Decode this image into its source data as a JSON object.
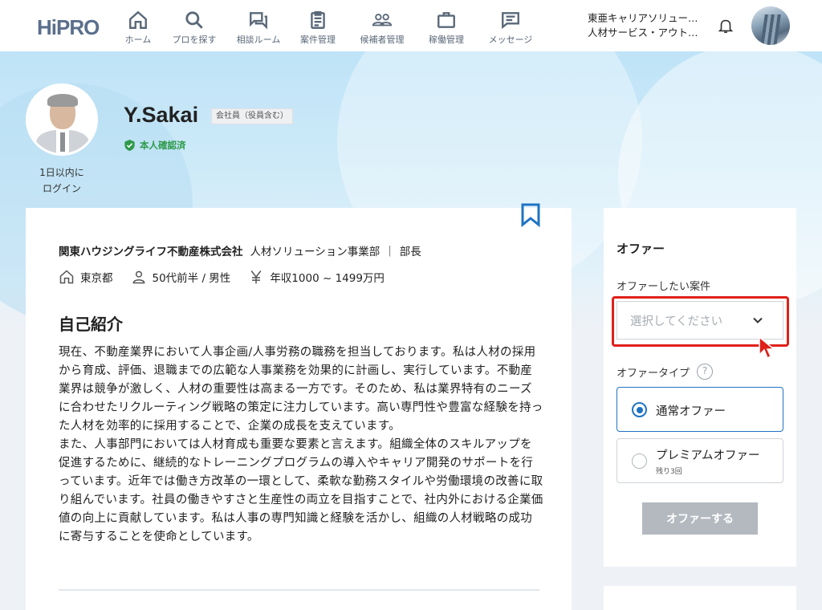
{
  "header": {
    "logo": "HiPRO",
    "nav": [
      {
        "id": "home",
        "label": "ホーム",
        "icon": "home-icon"
      },
      {
        "id": "search",
        "label": "プロを探す",
        "icon": "search-icon"
      },
      {
        "id": "consult",
        "label": "相談ルーム",
        "icon": "chat-icon"
      },
      {
        "id": "projects",
        "label": "案件管理",
        "icon": "clipboard-icon"
      },
      {
        "id": "candidates",
        "label": "候補者管理",
        "icon": "people-icon"
      },
      {
        "id": "work",
        "label": "稼働管理",
        "icon": "briefcase-icon"
      },
      {
        "id": "messages",
        "label": "メッセージ",
        "icon": "message-icon"
      }
    ],
    "company_line1": "東亜キャリアソリュー…",
    "company_line2": "人材サービス・アウト…"
  },
  "profile": {
    "login_line1": "1日以内に",
    "login_line2": "ログイン",
    "name": "Y.Sakai",
    "tag": "会社員（役員含む）",
    "verified": "本人確認済",
    "company": "関東ハウジングライフ不動産株式会社",
    "department": "人材ソリューション事業部",
    "position": "部長",
    "location": "東京都",
    "age_gender": "50代前半 / 男性",
    "income": "年収1000 ~ 1499万円"
  },
  "intro": {
    "title": "自己紹介",
    "body": "現在、不動産業界において人事企画/人事労務の職務を担当しております。私は人材の採用から育成、評価、退職までの広範な人事業務を効果的に計画し、実行しています。不動産業界は競争が激しく、人材の重要性は高まる一方です。そのため、私は業界特有のニーズに合わせたリクルーティング戦略の策定に注力しています。高い専門性や豊富な経験を持った人材を効率的に採用することで、企業の成長を支えています。\nまた、人事部門においては人材育成も重要な要素と言えます。組織全体のスキルアップを促進するために、継続的なトレーニングプログラムの導入やキャリア開発のサポートを行っています。近年では働き方改革の一環として、柔軟な勤務スタイルや労働環境の改善に取り組んでいます。社員の働きやすさと生産性の両立を目指すことで、社内外における企業価値の向上に貢献しています。私は人事の専門知識と経験を活かし、組織の人材戦略の成功に寄与することを使命としています。"
  },
  "offer": {
    "title": "オファー",
    "project_label": "オファーしたい案件",
    "project_placeholder": "選択してください",
    "type_label": "オファータイプ",
    "help": "?",
    "normal": "通常オファー",
    "premium": "プレミアムオファー",
    "premium_remaining": "残り3回",
    "selected_type": "normal",
    "submit": "オファーする"
  },
  "colors": {
    "accent": "#1f73c4",
    "highlight": "#e0201b",
    "verified": "#2e9a4a",
    "disabled_button": "#b3b9bf"
  }
}
